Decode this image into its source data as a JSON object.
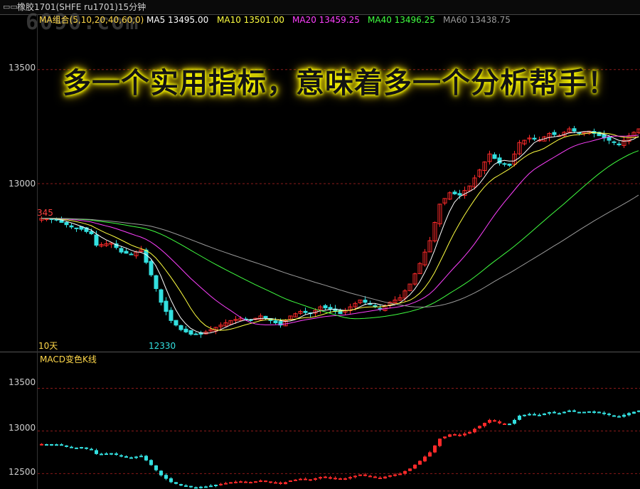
{
  "title_bar": {
    "text": "橡胶1701(SHFE ru1701)15分钟",
    "icon": "window-icon"
  },
  "watermark": "6090.com",
  "headline": "多一个实用指标，意味着多一个分析帮手！",
  "ma_legend": [
    {
      "text": "MA组合(5,10,20,40,60,0)",
      "color": "#ffd84a"
    },
    {
      "text": "MA5 13495.00",
      "color": "#ffffff"
    },
    {
      "text": "MA10 13501.00",
      "color": "#ffff40"
    },
    {
      "text": "MA20 13459.25",
      "color": "#ff40ff"
    },
    {
      "text": "MA40 13496.25",
      "color": "#40ff40"
    },
    {
      "text": "MA60 13438.75",
      "color": "#9a9a9a"
    }
  ],
  "colors": {
    "up": "#ff2a2a",
    "down": "#33e0e0",
    "grid": "#8b1a1a"
  },
  "chart_data": [
    {
      "type": "candlestick",
      "panel": "main",
      "y_ticks": [
        13500,
        13000
      ],
      "y_tick_labels": [
        "13500",
        "13000"
      ],
      "ylim": [
        12270,
        13680
      ],
      "high_label": "",
      "low_label": "12330",
      "left_label": "345",
      "period_label": "10天",
      "anchors": [
        [
          0,
          12848
        ],
        [
          3,
          12840
        ],
        [
          6,
          12810
        ],
        [
          8,
          12800
        ],
        [
          10,
          12780
        ],
        [
          11,
          12730
        ],
        [
          14,
          12740
        ],
        [
          16,
          12700
        ],
        [
          18,
          12690
        ],
        [
          20,
          12710
        ],
        [
          22,
          12600
        ],
        [
          24,
          12480
        ],
        [
          26,
          12400
        ],
        [
          28,
          12360
        ],
        [
          30,
          12340
        ],
        [
          32,
          12340
        ],
        [
          34,
          12360
        ],
        [
          36,
          12380
        ],
        [
          38,
          12400
        ],
        [
          40,
          12410
        ],
        [
          42,
          12400
        ],
        [
          44,
          12420
        ],
        [
          46,
          12400
        ],
        [
          48,
          12380
        ],
        [
          50,
          12420
        ],
        [
          52,
          12440
        ],
        [
          54,
          12430
        ],
        [
          56,
          12460
        ],
        [
          58,
          12450
        ],
        [
          60,
          12430
        ],
        [
          62,
          12460
        ],
        [
          64,
          12490
        ],
        [
          66,
          12470
        ],
        [
          68,
          12450
        ],
        [
          70,
          12480
        ],
        [
          72,
          12500
        ],
        [
          74,
          12560
        ],
        [
          76,
          12650
        ],
        [
          78,
          12750
        ],
        [
          80,
          12910
        ],
        [
          82,
          12960
        ],
        [
          84,
          12950
        ],
        [
          86,
          12990
        ],
        [
          88,
          13060
        ],
        [
          90,
          13130
        ],
        [
          92,
          13090
        ],
        [
          94,
          13080
        ],
        [
          96,
          13180
        ],
        [
          98,
          13200
        ],
        [
          100,
          13190
        ],
        [
          102,
          13220
        ],
        [
          104,
          13210
        ],
        [
          106,
          13240
        ],
        [
          108,
          13220
        ],
        [
          110,
          13230
        ],
        [
          112,
          13210
        ],
        [
          114,
          13190
        ],
        [
          116,
          13170
        ],
        [
          118,
          13210
        ],
        [
          120,
          13240
        ]
      ]
    },
    {
      "type": "candlestick",
      "panel": "macd",
      "label": "MACD变色K线",
      "y_ticks": [
        13500,
        13000,
        12500
      ],
      "y_tick_labels": [
        "13500",
        "13000",
        "12500"
      ],
      "ylim": [
        12320,
        13780
      ]
    }
  ]
}
